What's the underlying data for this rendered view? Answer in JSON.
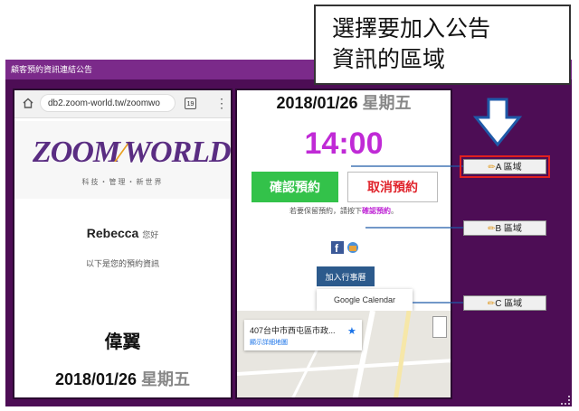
{
  "window": {
    "title": "顧客預約資訊連結公告"
  },
  "left_phone": {
    "url": "db2.zoom-world.tw/zoomwo",
    "tab_count": "19",
    "logo_text_1": "ZOOM",
    "logo_text_2": "WORLD",
    "logo_sub": "科技・管理・新世界",
    "user_name": "Rebecca",
    "greet_suffix": "您好",
    "info_text": "以下是您的預約資訊",
    "company": "偉翼",
    "date": "2018/01/26",
    "weekday": "星期五"
  },
  "mid_phone": {
    "date": "2018/01/26",
    "weekday": "星期五",
    "time": "14:00",
    "confirm_label": "確認預約",
    "cancel_label": "取消預約",
    "hint_prefix": "若要保留預約，請按下",
    "hint_link": "確認預約",
    "hint_suffix": "。",
    "add_calendar_label": "加入行事曆",
    "dropdown_option": "Google Calendar",
    "map_address": "407台中市西屯區市政...",
    "map_link": "顯示詳細地圖"
  },
  "areas": {
    "a": "A 區域",
    "b": "B 區域",
    "c": "C 區域"
  },
  "callout": {
    "line1": "選擇要加入公告",
    "line2": "資訊的區域"
  },
  "colors": {
    "window_bg": "#4d0d55",
    "titlebar": "#7b2a8a",
    "accent_purple": "#c02ad6",
    "confirm_green": "#33c24a",
    "cancel_red": "#e0242c",
    "highlight_red": "#e02020",
    "arrow_blue": "#1f5aa8"
  }
}
